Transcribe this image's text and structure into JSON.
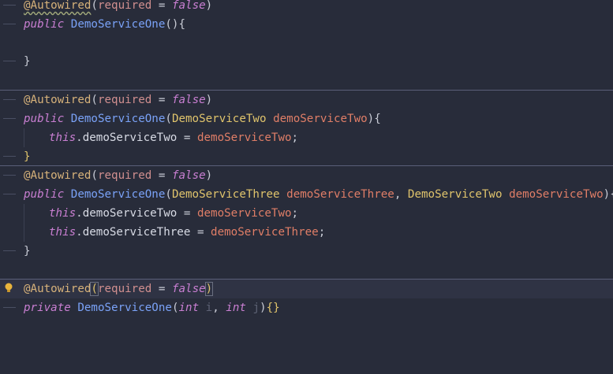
{
  "editor": {
    "annotation": "@Autowired",
    "annotation_param": "required",
    "annotation_value": "false",
    "eq": "=",
    "class_name": "DemoServiceOne",
    "kw_public": "public",
    "kw_private": "private",
    "kw_this": "this",
    "kw_int": "int",
    "type_two": "DemoServiceTwo",
    "type_three": "DemoServiceThree",
    "param_two": "demoServiceTwo",
    "param_three": "demoServiceThree",
    "field_two": "demoServiceTwo",
    "field_three": "demoServiceThree",
    "param_i": "i",
    "param_j": "j"
  },
  "colors": {
    "background": "#282c3a",
    "annotation": "#d7b27a",
    "keyword": "#c97fd2",
    "function": "#7aa2f7",
    "type": "#e0c46c",
    "parameter": "#e07e67"
  },
  "icons": {
    "gutter": "lightbulb-icon"
  }
}
